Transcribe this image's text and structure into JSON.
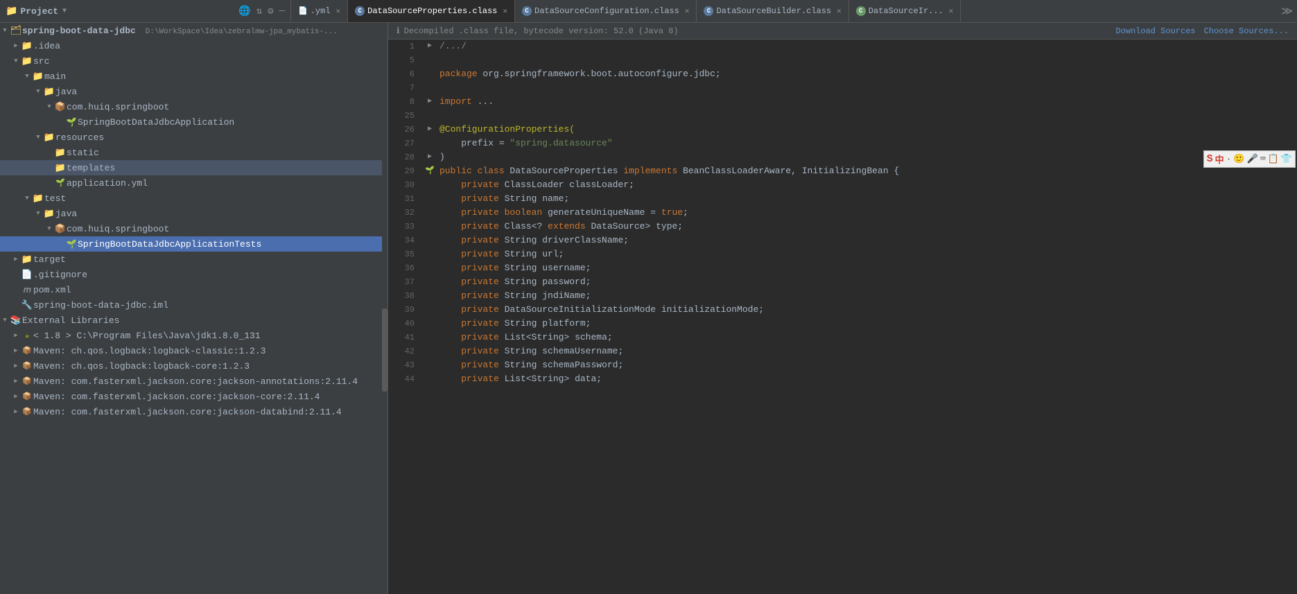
{
  "window": {
    "title": "Project"
  },
  "project": {
    "name": "spring-boot-data-jdbc",
    "path": "D:\\WorkSpace\\Idea\\zebralmw-jpa_mybatis-..."
  },
  "tabs": [
    {
      "id": "yml",
      "label": "...yml",
      "icon": "yml",
      "active": false,
      "closeable": true
    },
    {
      "id": "ds-props",
      "label": "DataSourceProperties.class",
      "icon": "class",
      "active": true,
      "closeable": true
    },
    {
      "id": "ds-config",
      "label": "DataSourceConfiguration.class",
      "icon": "class",
      "active": false,
      "closeable": true
    },
    {
      "id": "ds-builder",
      "label": "DataSourceBuilder.class",
      "icon": "class",
      "active": false,
      "closeable": true
    },
    {
      "id": "ds-impl",
      "label": "DataSourceIr...",
      "icon": "class",
      "active": false,
      "closeable": true
    }
  ],
  "editor": {
    "banner_text": "Decompiled .class file, bytecode version: 52.0 (Java 8)",
    "download_sources_label": "Download Sources",
    "choose_sources_label": "Choose Sources..."
  },
  "code_lines": [
    {
      "num": 1,
      "gutter": "fold",
      "content": [
        {
          "type": "fold_marker",
          "text": "/.../"
        }
      ]
    },
    {
      "num": 5,
      "content": []
    },
    {
      "num": 6,
      "content": [
        {
          "type": "kw",
          "text": "package "
        },
        {
          "type": "plain",
          "text": "org.springframework.boot.autoconfigure.jdbc;"
        }
      ]
    },
    {
      "num": 7,
      "content": []
    },
    {
      "num": 8,
      "gutter": "fold",
      "content": [
        {
          "type": "kw",
          "text": "import"
        },
        {
          "type": "plain",
          "text": " ..."
        }
      ]
    },
    {
      "num": 25,
      "content": []
    },
    {
      "num": 26,
      "gutter": "fold",
      "content": [
        {
          "type": "ann",
          "text": "@ConfigurationProperties("
        }
      ]
    },
    {
      "num": 27,
      "content": [
        {
          "type": "plain",
          "text": "    prefix = "
        },
        {
          "type": "str",
          "text": "\"spring.datasource\""
        }
      ]
    },
    {
      "num": 28,
      "gutter": "fold",
      "content": [
        {
          "type": "plain",
          "text": ")"
        }
      ]
    },
    {
      "num": 29,
      "gutter": "spring",
      "content": [
        {
          "type": "kw",
          "text": "public "
        },
        {
          "type": "kw",
          "text": "class "
        },
        {
          "type": "cls",
          "text": "DataSourceProperties "
        },
        {
          "type": "kw",
          "text": "implements "
        },
        {
          "type": "cls",
          "text": "BeanClassLoaderAware"
        },
        {
          "type": "plain",
          "text": ", "
        },
        {
          "type": "cls",
          "text": "InitializingBean"
        },
        {
          "type": "plain",
          "text": " {"
        }
      ]
    },
    {
      "num": 30,
      "content": [
        {
          "type": "kw",
          "text": "    private "
        },
        {
          "type": "cls",
          "text": "ClassLoader"
        },
        {
          "type": "plain",
          "text": " classLoader;"
        }
      ]
    },
    {
      "num": 31,
      "content": [
        {
          "type": "kw",
          "text": "    private "
        },
        {
          "type": "cls",
          "text": "String"
        },
        {
          "type": "plain",
          "text": " name;"
        }
      ]
    },
    {
      "num": 32,
      "content": [
        {
          "type": "kw",
          "text": "    private "
        },
        {
          "type": "kw2",
          "text": "boolean"
        },
        {
          "type": "plain",
          "text": " generateUniqueName = "
        },
        {
          "type": "kw",
          "text": "true"
        },
        {
          "type": "plain",
          "text": ";"
        }
      ]
    },
    {
      "num": 33,
      "content": [
        {
          "type": "kw",
          "text": "    private "
        },
        {
          "type": "cls",
          "text": "Class"
        },
        {
          "type": "plain",
          "text": "<? "
        },
        {
          "type": "kw",
          "text": "extends "
        },
        {
          "type": "cls",
          "text": "DataSource"
        },
        {
          "type": "plain",
          "text": "> type;"
        }
      ]
    },
    {
      "num": 34,
      "content": [
        {
          "type": "kw",
          "text": "    private "
        },
        {
          "type": "cls",
          "text": "String"
        },
        {
          "type": "plain",
          "text": " driverClassName;"
        }
      ]
    },
    {
      "num": 35,
      "content": [
        {
          "type": "kw",
          "text": "    private "
        },
        {
          "type": "cls",
          "text": "String"
        },
        {
          "type": "plain",
          "text": " url;"
        }
      ]
    },
    {
      "num": 36,
      "content": [
        {
          "type": "kw",
          "text": "    private "
        },
        {
          "type": "cls",
          "text": "String"
        },
        {
          "type": "plain",
          "text": " username;"
        }
      ]
    },
    {
      "num": 37,
      "content": [
        {
          "type": "kw",
          "text": "    private "
        },
        {
          "type": "cls",
          "text": "String"
        },
        {
          "type": "plain",
          "text": " password;"
        }
      ]
    },
    {
      "num": 38,
      "content": [
        {
          "type": "kw",
          "text": "    private "
        },
        {
          "type": "cls",
          "text": "String"
        },
        {
          "type": "plain",
          "text": " jndiName;"
        }
      ]
    },
    {
      "num": 39,
      "content": [
        {
          "type": "kw",
          "text": "    private "
        },
        {
          "type": "cls",
          "text": "DataSourceInitializationMode"
        },
        {
          "type": "plain",
          "text": " initializationMode;"
        }
      ]
    },
    {
      "num": 40,
      "content": [
        {
          "type": "kw",
          "text": "    private "
        },
        {
          "type": "cls",
          "text": "String"
        },
        {
          "type": "plain",
          "text": " platform;"
        }
      ]
    },
    {
      "num": 41,
      "content": [
        {
          "type": "kw",
          "text": "    private "
        },
        {
          "type": "cls",
          "text": "List"
        },
        {
          "type": "plain",
          "text": "<"
        },
        {
          "type": "cls",
          "text": "String"
        },
        {
          "type": "plain",
          "text": "> schema;"
        }
      ]
    },
    {
      "num": 42,
      "content": [
        {
          "type": "kw",
          "text": "    private "
        },
        {
          "type": "cls",
          "text": "String"
        },
        {
          "type": "plain",
          "text": " schemaUsername;"
        }
      ]
    },
    {
      "num": 43,
      "content": [
        {
          "type": "kw",
          "text": "    private "
        },
        {
          "type": "cls",
          "text": "String"
        },
        {
          "type": "plain",
          "text": " schemaPassword;"
        }
      ]
    },
    {
      "num": 44,
      "content": [
        {
          "type": "kw",
          "text": "    private "
        },
        {
          "type": "cls",
          "text": "List"
        },
        {
          "type": "plain",
          "text": "<"
        },
        {
          "type": "cls",
          "text": "String"
        },
        {
          "type": "plain",
          "text": "> data;"
        }
      ]
    }
  ],
  "tree": [
    {
      "depth": 0,
      "arrow": "▼",
      "icon": "project",
      "label": "spring-boot-data-jdbc",
      "hint": "D:\\WorkSpace\\Idea\\zebralmw-jpa_mybatis-..."
    },
    {
      "depth": 1,
      "arrow": "▶",
      "icon": "folder",
      "label": ".idea"
    },
    {
      "depth": 1,
      "arrow": "▼",
      "icon": "folder-src",
      "label": "src"
    },
    {
      "depth": 2,
      "arrow": "▼",
      "icon": "folder",
      "label": "main"
    },
    {
      "depth": 3,
      "arrow": "▼",
      "icon": "folder-java",
      "label": "java"
    },
    {
      "depth": 4,
      "arrow": "▼",
      "icon": "folder-pkg",
      "label": "com.huiq.springboot"
    },
    {
      "depth": 5,
      "arrow": "",
      "icon": "spring-class",
      "label": "SpringBootDataJdbcApplication"
    },
    {
      "depth": 3,
      "arrow": "▼",
      "icon": "folder-res",
      "label": "resources"
    },
    {
      "depth": 4,
      "arrow": "",
      "icon": "folder-plain",
      "label": "static"
    },
    {
      "depth": 4,
      "arrow": "",
      "icon": "folder-plain",
      "label": "templates"
    },
    {
      "depth": 4,
      "arrow": "",
      "icon": "yml",
      "label": "application.yml"
    },
    {
      "depth": 2,
      "arrow": "▼",
      "icon": "folder",
      "label": "test"
    },
    {
      "depth": 3,
      "arrow": "▼",
      "icon": "folder-java",
      "label": "java"
    },
    {
      "depth": 4,
      "arrow": "▼",
      "icon": "folder-pkg",
      "label": "com.huiq.springboot"
    },
    {
      "depth": 5,
      "arrow": "",
      "icon": "test-class",
      "label": "SpringBootDataJdbcApplicationTests",
      "selected": true
    },
    {
      "depth": 1,
      "arrow": "▶",
      "icon": "folder-target",
      "label": "target"
    },
    {
      "depth": 1,
      "arrow": "",
      "icon": "git",
      "label": ".gitignore"
    },
    {
      "depth": 1,
      "arrow": "",
      "icon": "xml",
      "label": "pom.xml"
    },
    {
      "depth": 1,
      "arrow": "",
      "icon": "iml",
      "label": "spring-boot-data-jdbc.iml"
    },
    {
      "depth": 0,
      "arrow": "▼",
      "icon": "ext-lib",
      "label": "External Libraries"
    },
    {
      "depth": 1,
      "arrow": "▶",
      "icon": "jdk",
      "label": "< 1.8 > C:\\Program Files\\Java\\jdk1.8.0_131"
    },
    {
      "depth": 1,
      "arrow": "▶",
      "icon": "maven",
      "label": "Maven: ch.qos.logback:logback-classic:1.2.3"
    },
    {
      "depth": 1,
      "arrow": "▶",
      "icon": "maven",
      "label": "Maven: ch.qos.logback:logback-core:1.2.3"
    },
    {
      "depth": 1,
      "arrow": "▶",
      "icon": "maven",
      "label": "Maven: com.fasterxml.jackson.core:jackson-annotations:2.11.4"
    },
    {
      "depth": 1,
      "arrow": "▶",
      "icon": "maven",
      "label": "Maven: com.fasterxml.jackson.core:jackson-core:2.11.4"
    },
    {
      "depth": 1,
      "arrow": "▶",
      "icon": "maven",
      "label": "Maven: com.fasterxml.jackson.core:jackson-databind:2.11.4"
    }
  ]
}
